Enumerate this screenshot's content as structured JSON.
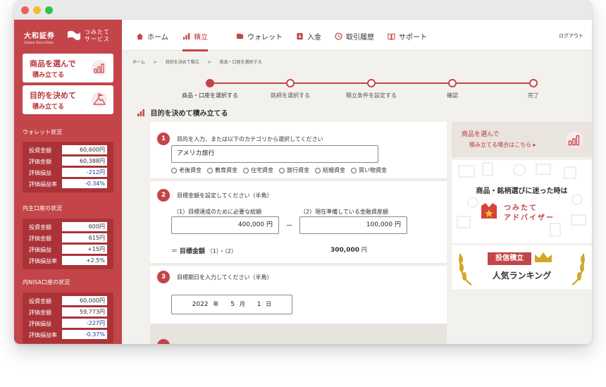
{
  "brand": {
    "name": "大和証券",
    "sub_name": "Daiwa Securities",
    "service_line1": "つみたて",
    "service_line2": "サービス"
  },
  "sidebar": {
    "card_product": {
      "line1": "商品を選んで",
      "line2": "積み立てる"
    },
    "card_goal": {
      "line1": "目的を決めて",
      "line2": "積み立てる"
    },
    "sections": [
      {
        "title": "ウォレット状況",
        "rows": [
          {
            "k": "投資金額",
            "v": "60,600円"
          },
          {
            "k": "評価金額",
            "v": "60,388円"
          },
          {
            "k": "評価損益",
            "v": "-212円"
          },
          {
            "k": "評価損益率",
            "v": "-0.34%"
          }
        ]
      },
      {
        "title": "内主口座の状況",
        "rows": [
          {
            "k": "投資金額",
            "v": "600円"
          },
          {
            "k": "評価金額",
            "v": "615円"
          },
          {
            "k": "評価損益",
            "v": "+15円"
          },
          {
            "k": "評価損益率",
            "v": "+2.5%"
          }
        ]
      },
      {
        "title": "内NISA口座の状況",
        "rows": [
          {
            "k": "投資金額",
            "v": "60,000円"
          },
          {
            "k": "評価金額",
            "v": "59,773円"
          },
          {
            "k": "評価損益",
            "v": "-227円"
          },
          {
            "k": "評価損益率",
            "v": "-0.37%"
          }
        ]
      }
    ]
  },
  "nav": {
    "home": "ホーム",
    "tsumitate": "積立",
    "wallet": "ウォレット",
    "deposit": "入金",
    "history": "取引履歴",
    "support": "サポート",
    "logout": "ログアウト"
  },
  "breadcrumb": {
    "c1": "ホーム",
    "sep": ">",
    "c2": "目的を決めて積立",
    "c3": "商品・口座を選択する"
  },
  "stepper": {
    "steps": [
      "商品・口座を選択する",
      "銘柄を選択する",
      "積立条件を設定する",
      "確認",
      "完了"
    ],
    "current": 1
  },
  "page_title": "目的を決めて積み立てる",
  "form": {
    "s1": {
      "num": "1",
      "question": "目的を入力、または以下のカテゴリから選択してください",
      "value": "アメリカ旅行",
      "options": [
        "老後資金",
        "教育資金",
        "住宅資金",
        "旅行資金",
        "結婚資金",
        "買い物資金"
      ]
    },
    "s2": {
      "num": "2",
      "question": "目標金額を設定してください（半角）",
      "label1": "（1）目標達成のために必要な総額",
      "label2": "（2）現在準備している金融資産額",
      "value1": "400,000",
      "value2": "100,000",
      "unit": "円",
      "minus": "ー",
      "result_prefix": "＝",
      "result_label": "目標金額",
      "result_formula": "（1）・（2）",
      "result_value": "300,000",
      "result_unit": "円"
    },
    "s3": {
      "num": "3",
      "question": "目標期日を入力してください（半角）",
      "year": "2022",
      "year_unit": "年",
      "month": "5",
      "month_unit": "月",
      "day": "1",
      "day_unit": "日"
    }
  },
  "right": {
    "product_card": {
      "line1": "商品を選んで",
      "line2": "積み立てる場合はこちら ▸"
    },
    "advisor_card": {
      "headline": "商品・銘柄選びに迷った時は",
      "name1": "つみたて",
      "name2": "アドバイザー"
    },
    "ranking_card": {
      "line1": "投信積立",
      "line2": "人気ランキング"
    }
  },
  "colors": {
    "brand_red": "#c34549",
    "dark_red": "#ab3338",
    "neg_blue": "#1a3c9c",
    "gold": "#c89b1e"
  }
}
